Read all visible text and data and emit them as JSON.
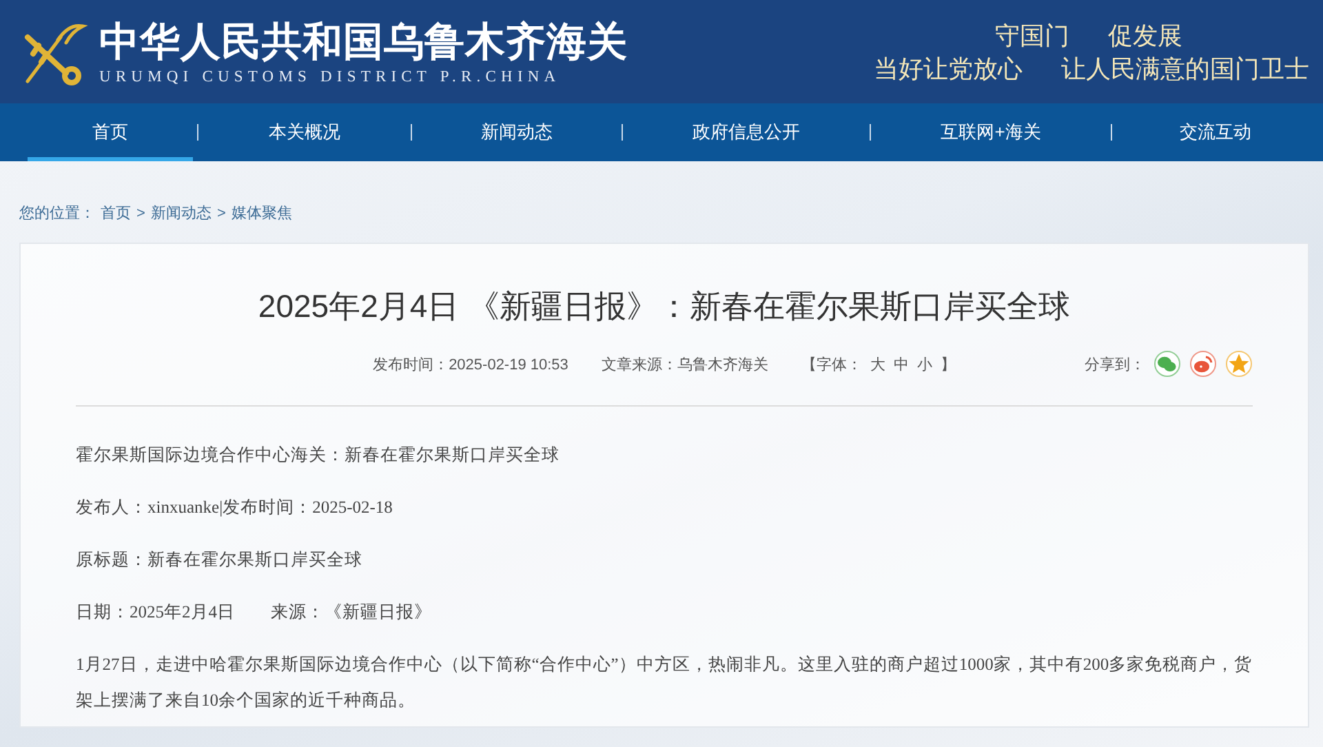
{
  "header": {
    "title": "中华人民共和国乌鲁木齐海关",
    "subtitle": "URUMQI CUSTOMS DISTRICT P.R.CHINA",
    "slogans": [
      [
        "守国门",
        "促发展"
      ],
      [
        "当好让党放心",
        "让人民满意的国门卫士"
      ]
    ]
  },
  "nav": [
    {
      "label": "首页",
      "selected": true
    },
    {
      "label": "本关概况",
      "selected": false
    },
    {
      "label": "新闻动态",
      "selected": false
    },
    {
      "label": "政府信息公开",
      "selected": false
    },
    {
      "label": "互联网+海关",
      "selected": false
    },
    {
      "label": "交流互动",
      "selected": false
    }
  ],
  "breadcrumb": {
    "label": "您的位置：",
    "items": [
      "首页",
      "新闻动态",
      "媒体聚焦"
    ],
    "separator": ">"
  },
  "article": {
    "title": "2025年2月4日 《新疆日报》：新春在霍尔果斯口岸买全球",
    "meta": {
      "published": "发布时间：2025-02-19 10:53",
      "source": "文章来源：乌鲁木齐海关",
      "font_label": "【字体：",
      "font_sizes": [
        "大",
        "中",
        "小"
      ],
      "font_end": "】",
      "share_label": "分享到："
    },
    "share": [
      {
        "kind": "wechat",
        "color": "#4caf50"
      },
      {
        "kind": "weibo",
        "color": "#e8553a"
      },
      {
        "kind": "favorite",
        "color": "#f2a516"
      }
    ],
    "paragraphs": [
      "霍尔果斯国际边境合作中心海关：新春在霍尔果斯口岸买全球",
      "发布人：xinxuanke|发布时间：2025-02-18",
      "原标题：新春在霍尔果斯口岸买全球",
      "日期：2025年2月4日　　来源：《新疆日报》",
      "1月27日，走进中哈霍尔果斯国际边境合作中心（以下简称“合作中心”）中方区，热闹非凡。这里入驻的商户超过1000家，其中有200多家免税商户，货架上摆满了来自10余个国家的近千种商品。"
    ]
  }
}
